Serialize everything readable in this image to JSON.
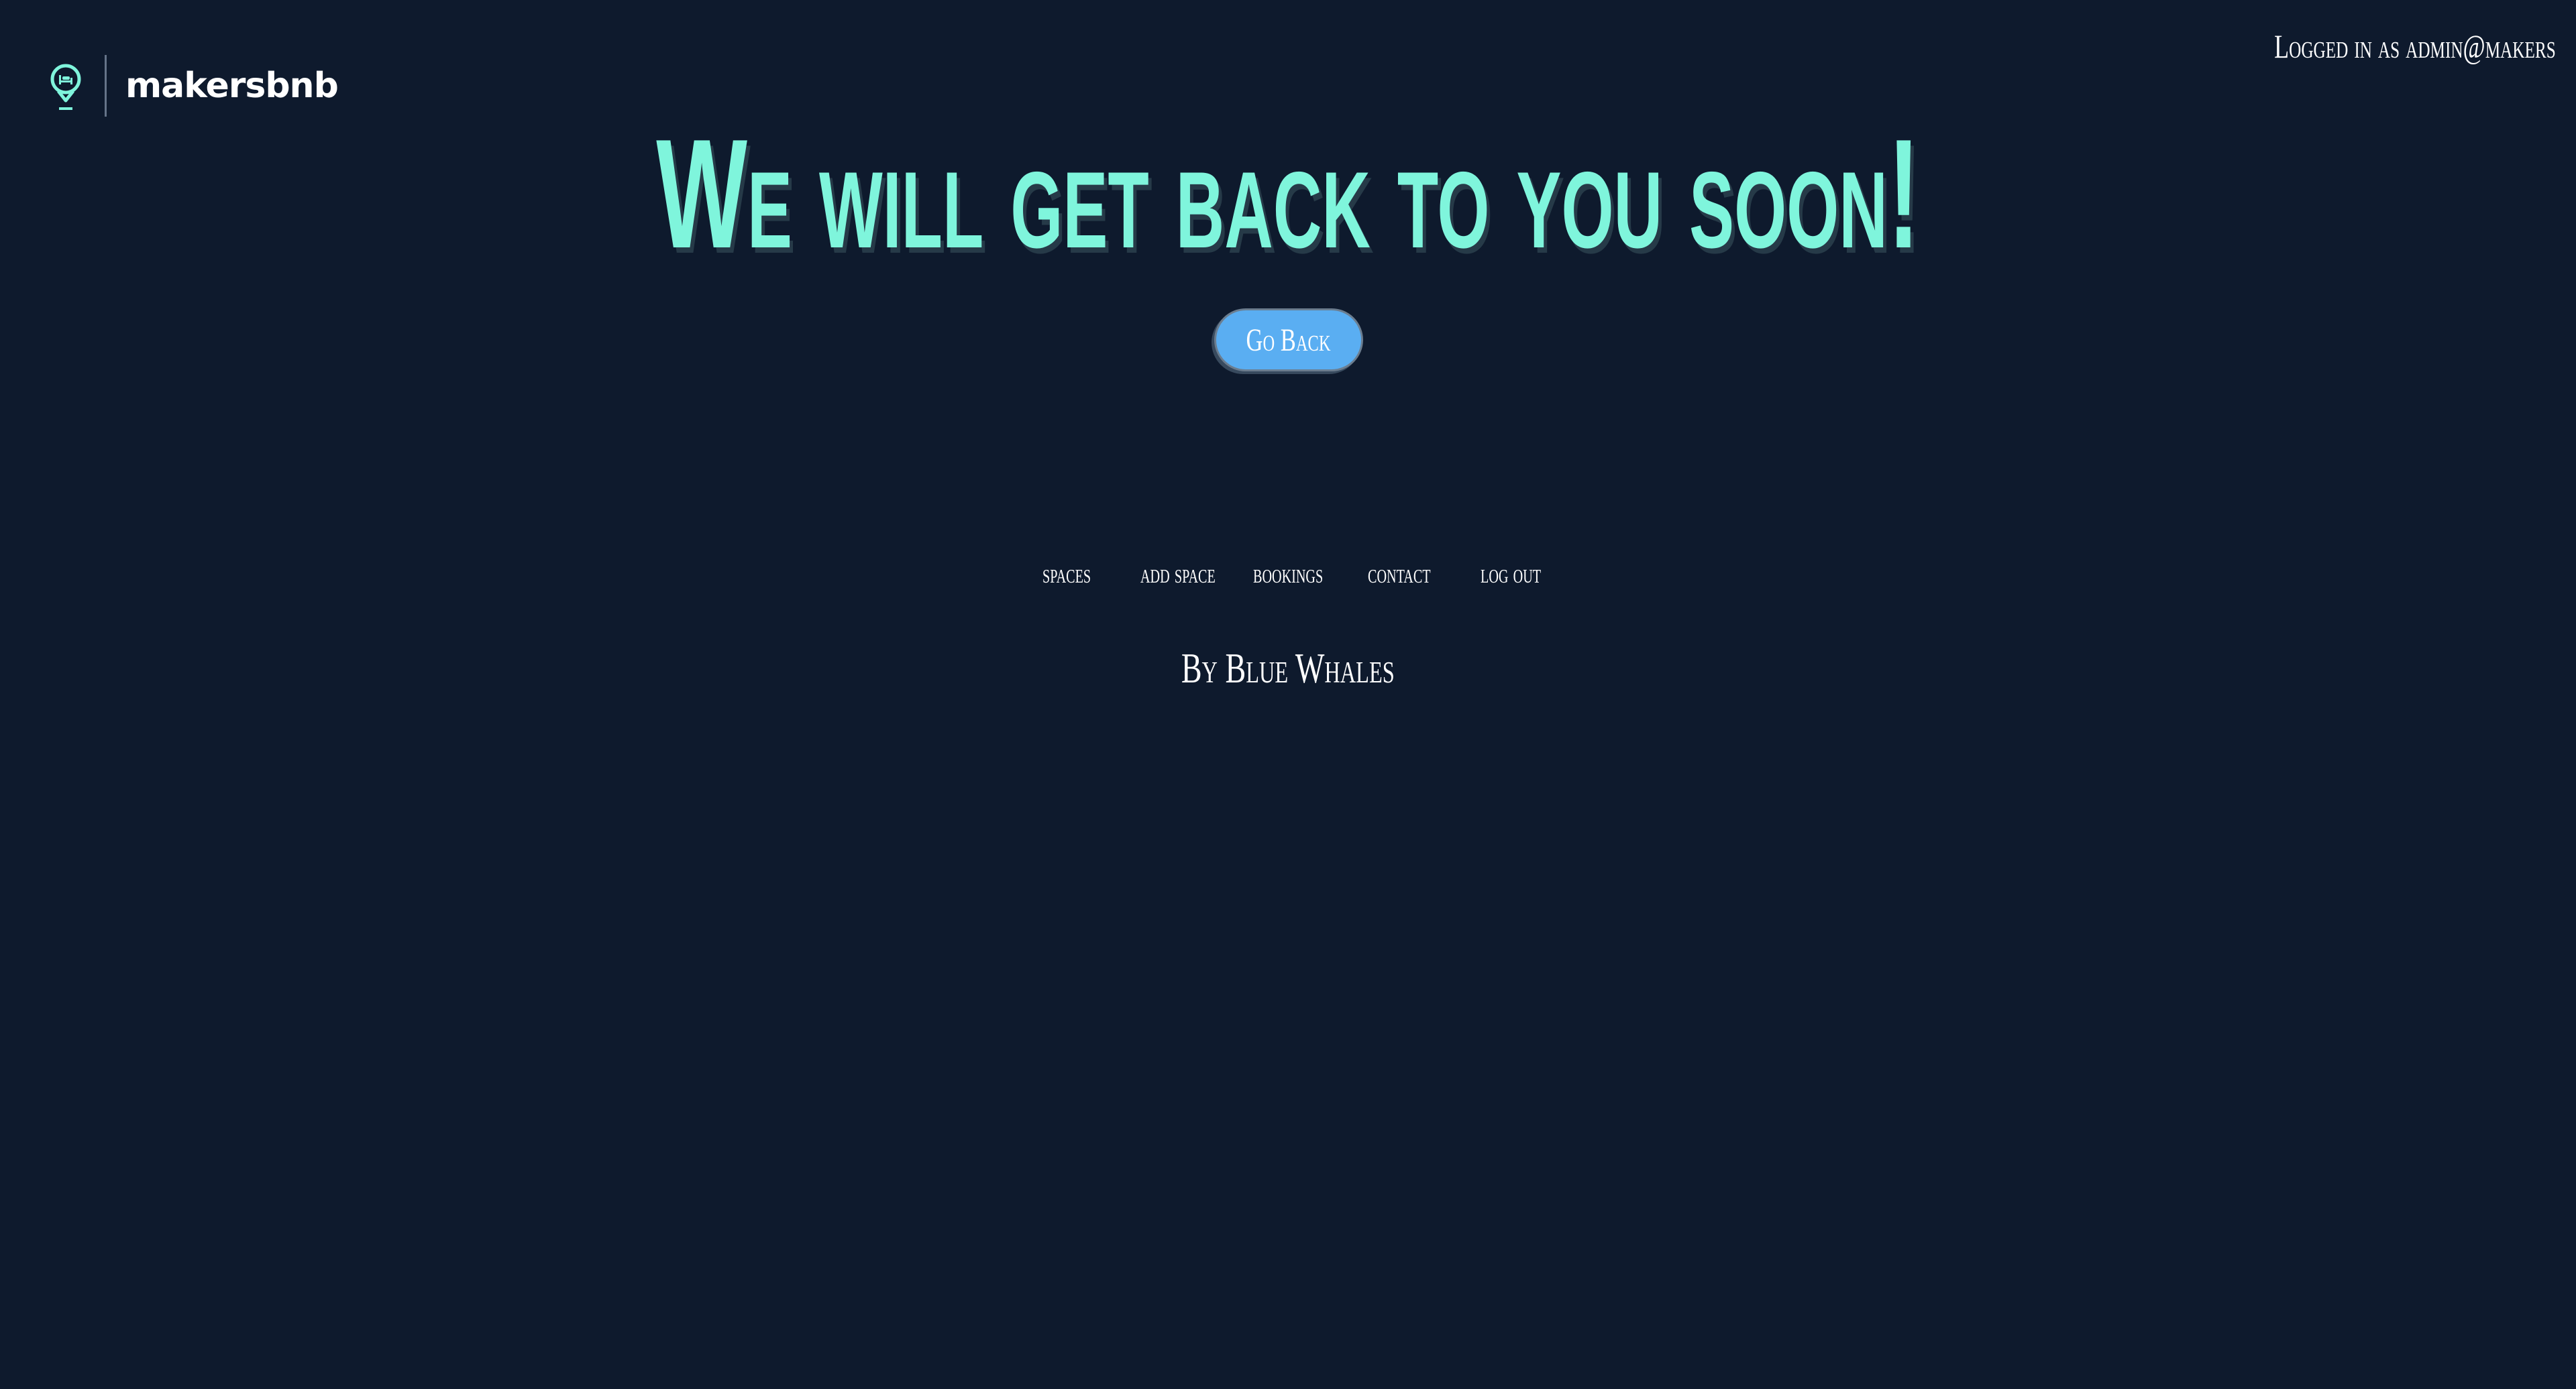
{
  "header": {
    "brand_name": "makersbnb",
    "brand_icon": "map-pin-bed-icon",
    "login_status": "Logged in as admin@makers"
  },
  "main": {
    "heading": "We will get back to you soon!",
    "go_back_label": "Go Back"
  },
  "footer": {
    "nav": [
      {
        "label": "spaces"
      },
      {
        "label": "add space"
      },
      {
        "label": "bookings"
      },
      {
        "label": "contact"
      },
      {
        "label": "log out"
      }
    ],
    "credit": "By Blue Whales"
  },
  "colors": {
    "background": "#0e1a2d",
    "accent": "#7ff5dc",
    "button": "#5aaef2",
    "text": "#ffffff"
  }
}
